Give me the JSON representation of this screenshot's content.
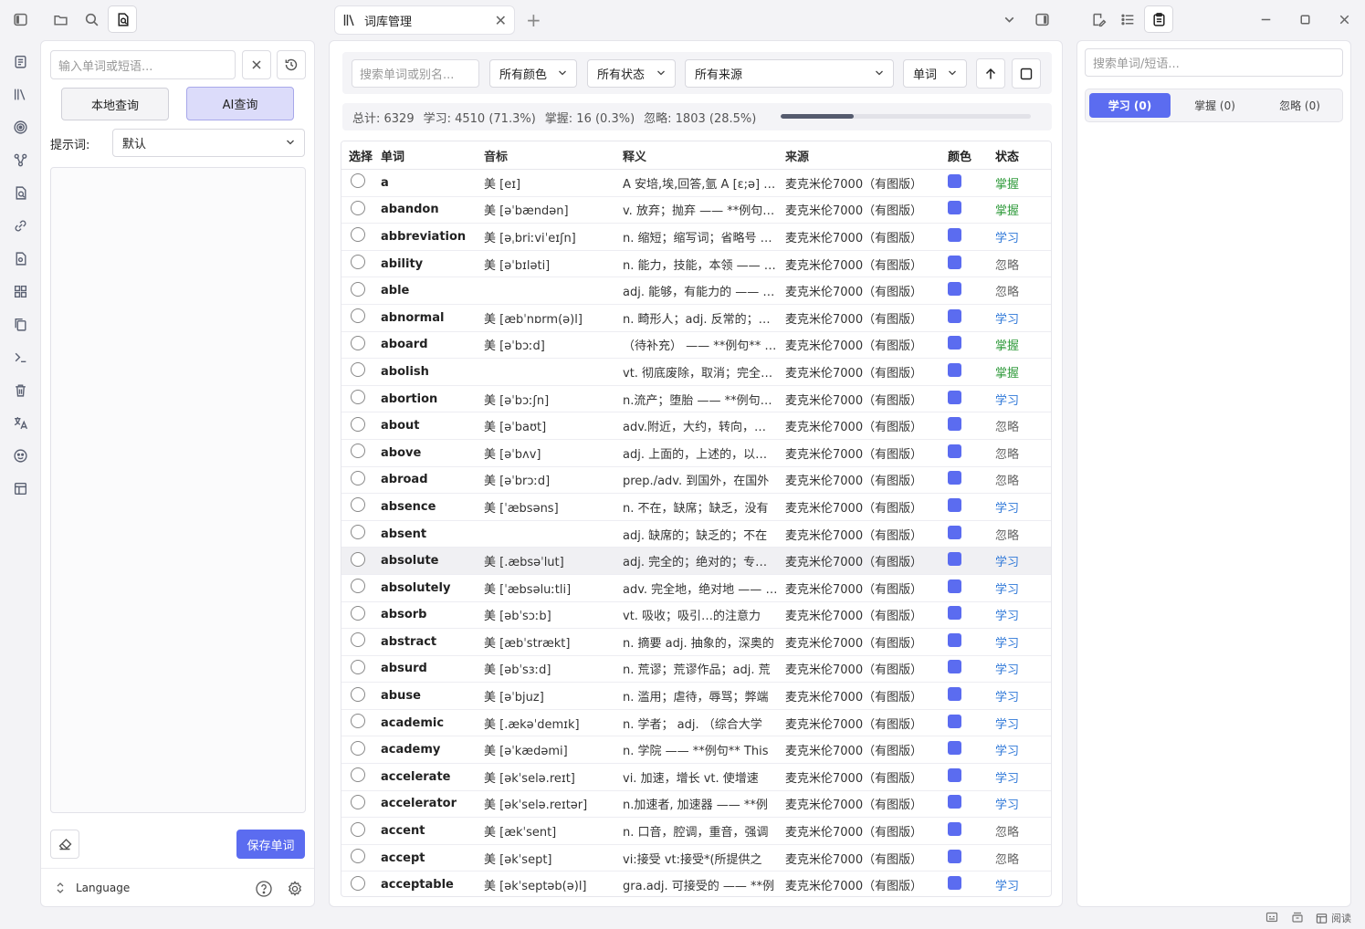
{
  "topbar": {
    "tab_label": "词库管理"
  },
  "left": {
    "input_placeholder": "输入单词或短语...",
    "local_query": "本地查询",
    "ai_query": "AI查询",
    "prompt_label": "提示词:",
    "prompt_value": "默认",
    "save_label": "保存单词",
    "language_label": "Language"
  },
  "mid": {
    "search_placeholder": "搜索单词或别名...",
    "filter_color": "所有颜色",
    "filter_status": "所有状态",
    "filter_source": "所有来源",
    "filter_type": "单词",
    "stats": {
      "total": "总计: 6329",
      "learn": "学习: 4510 (71.3%)",
      "master": "掌握: 16 (0.3%)",
      "ignore": "忽略: 1803 (28.5%)",
      "progress": 0.293
    },
    "headers": [
      "选择",
      "单词",
      "音标",
      "释义",
      "来源",
      "颜色",
      "状态"
    ],
    "swatch_color": "#5b6cf0",
    "rows": [
      {
        "word": "a",
        "ph": "美 [eɪ]",
        "def": "A 安培,埃,回答,氩 A [ɛ;ə] art. 一",
        "src": "麦克米伦7000（有图版）",
        "status": "掌握"
      },
      {
        "word": "abandon",
        "ph": "美 [əˈbændən]",
        "def": "v. 放弃；抛弃 —— **例句** He",
        "src": "麦克米伦7000（有图版）",
        "status": "掌握"
      },
      {
        "word": "abbreviation",
        "ph": "美 [əˌbriːviˈeɪʃn]",
        "def": "n. 缩短；缩写词；省略号 ——",
        "src": "麦克米伦7000（有图版）",
        "status": "学习"
      },
      {
        "word": "ability",
        "ph": "美 [əˈbɪləti]",
        "def": "n. 能力，技能，本领 —— **例",
        "src": "麦克米伦7000（有图版）",
        "status": "忽略"
      },
      {
        "word": "able",
        "ph": "",
        "def": "adj. 能够，有能力的 —— **例",
        "src": "麦克米伦7000（有图版）",
        "status": "忽略"
      },
      {
        "word": "abnormal",
        "ph": "美 [æbˈnɒrm(ə)l]",
        "def": "n. 畸形人；adj. 反常的；不规",
        "src": "麦克米伦7000（有图版）",
        "status": "学习"
      },
      {
        "word": "aboard",
        "ph": "美 [əˈbɔːd]",
        "def": "（待补充） —— **例句** Are",
        "src": "麦克米伦7000（有图版）",
        "status": "掌握"
      },
      {
        "word": "abolish",
        "ph": "",
        "def": "vt. 彻底废除，取消；完全破坏",
        "src": "麦克米伦7000（有图版）",
        "status": "掌握"
      },
      {
        "word": "abortion",
        "ph": "美 [əˈbɔːʃn]",
        "def": "n.流产；堕胎 —— **例句** He",
        "src": "麦克米伦7000（有图版）",
        "status": "学习"
      },
      {
        "word": "about",
        "ph": "美 [əˈbaʊt]",
        "def": "adv.附近，大约，转向，周围",
        "src": "麦克米伦7000（有图版）",
        "status": "忽略"
      },
      {
        "word": "above",
        "ph": "美 [əˈbʌv]",
        "def": "adj. 上面的，上述的，以上的",
        "src": "麦克米伦7000（有图版）",
        "status": "忽略"
      },
      {
        "word": "abroad",
        "ph": "美 [əˈbrɔːd]",
        "def": "prep./adv. 到国外，在国外",
        "src": "麦克米伦7000（有图版）",
        "status": "忽略"
      },
      {
        "word": "absence",
        "ph": "美 [ˈæbsəns]",
        "def": "n. 不在，缺席；缺乏，没有",
        "src": "麦克米伦7000（有图版）",
        "status": "学习"
      },
      {
        "word": "absent",
        "ph": "",
        "def": "adj. 缺席的；缺乏的；不在",
        "src": "麦克米伦7000（有图版）",
        "status": "忽略"
      },
      {
        "word": "absolute",
        "ph": "美 [.æbsəˈlut]",
        "def": "adj. 完全的；绝对的；专制的",
        "src": "麦克米伦7000（有图版）",
        "status": "学习",
        "hl": true
      },
      {
        "word": "absolutely",
        "ph": "美 [ˈæbsəluːtli]",
        "def": "adv. 完全地，绝对地 —— **例",
        "src": "麦克米伦7000（有图版）",
        "status": "学习"
      },
      {
        "word": "absorb",
        "ph": "美 [əbˈsɔːb]",
        "def": "vt. 吸收；吸引…的注意力",
        "src": "麦克米伦7000（有图版）",
        "status": "学习"
      },
      {
        "word": "abstract",
        "ph": "美 [æbˈstrækt]",
        "def": "n. 摘要 adj. 抽象的，深奥的",
        "src": "麦克米伦7000（有图版）",
        "status": "学习"
      },
      {
        "word": "absurd",
        "ph": "美 [əbˈsɜːd]",
        "def": "n. 荒谬；荒谬作品；adj. 荒",
        "src": "麦克米伦7000（有图版）",
        "status": "学习"
      },
      {
        "word": "abuse",
        "ph": "美 [əˈbjuz]",
        "def": "n. 滥用；虐待，辱骂；弊端",
        "src": "麦克米伦7000（有图版）",
        "status": "学习"
      },
      {
        "word": "academic",
        "ph": "美 [.ækəˈdemɪk]",
        "def": "n. 学者； adj. （综合大学",
        "src": "麦克米伦7000（有图版）",
        "status": "学习"
      },
      {
        "word": "academy",
        "ph": "美 [əˈkædəmi]",
        "def": "n. 学院 —— **例句** This",
        "src": "麦克米伦7000（有图版）",
        "status": "学习"
      },
      {
        "word": "accelerate",
        "ph": "美 [əkˈselə.reɪt]",
        "def": "vi. 加速，增长 vt. 使增速",
        "src": "麦克米伦7000（有图版）",
        "status": "学习"
      },
      {
        "word": "accelerator",
        "ph": "美 [əkˈselə.reɪtər]",
        "def": "n.加速者, 加速器 —— **例",
        "src": "麦克米伦7000（有图版）",
        "status": "学习"
      },
      {
        "word": "accent",
        "ph": "美 [ækˈsent]",
        "def": "n. 口音，腔调，重音，强调",
        "src": "麦克米伦7000（有图版）",
        "status": "忽略"
      },
      {
        "word": "accept",
        "ph": "美 [əkˈsept]",
        "def": "vi:接受 vt:接受*(所提供之",
        "src": "麦克米伦7000（有图版）",
        "status": "忽略"
      },
      {
        "word": "acceptable",
        "ph": "美 [əkˈseptəb(ə)l]",
        "def": "gra.adj. 可接受的 —— **例",
        "src": "麦克米伦7000（有图版）",
        "status": "学习"
      }
    ]
  },
  "right": {
    "search_placeholder": "搜索单词/短语...",
    "tab_learn": "学习 (0)",
    "tab_master": "掌握 (0)",
    "tab_ignore": "忽略 (0)"
  },
  "statusbar": {
    "read_label": "阅读"
  }
}
